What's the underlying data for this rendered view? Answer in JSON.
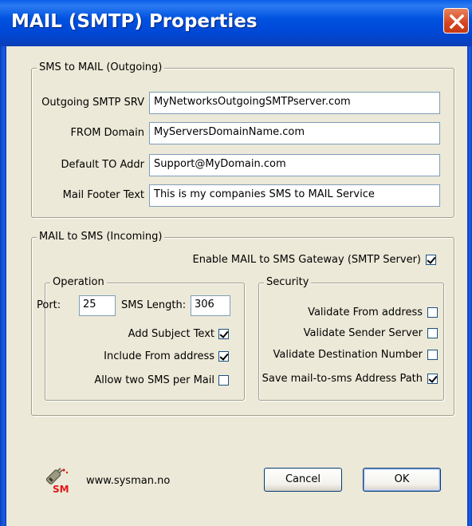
{
  "window": {
    "title": "MAIL (SMTP) Properties"
  },
  "outgoing": {
    "legend": "SMS to MAIL (Outgoing)",
    "smtp_srv_label": "Outgoing SMTP SRV",
    "smtp_srv_value": "MyNetworksOutgoingSMTPserver.com",
    "from_domain_label": "FROM Domain",
    "from_domain_value": "MyServersDomainName.com",
    "default_to_label": "Default TO Addr",
    "default_to_value": "Support@MyDomain.com",
    "footer_label": "Mail Footer Text",
    "footer_value": "This is my companies SMS to MAIL Service"
  },
  "incoming": {
    "legend": "MAIL to SMS (Incoming)",
    "enable_label": "Enable MAIL to SMS Gateway (SMTP Server)",
    "enable_checked": true,
    "operation": {
      "legend": "Operation",
      "port_label": "Port:",
      "port_value": "25",
      "sms_length_label": "SMS Length:",
      "sms_length_value": "306",
      "add_subject_label": "Add Subject Text",
      "add_subject_checked": true,
      "include_from_label": "Include From address",
      "include_from_checked": true,
      "allow_two_label": "Allow two SMS per Mail",
      "allow_two_checked": false
    },
    "security": {
      "legend": "Security",
      "validate_from_label": "Validate From address",
      "validate_from_checked": false,
      "validate_sender_label": "Validate Sender Server",
      "validate_sender_checked": false,
      "validate_dest_label": "Validate Destination Number",
      "validate_dest_checked": false,
      "save_path_label": "Save mail-to-sms Address Path",
      "save_path_checked": true
    }
  },
  "footer": {
    "logo_text": "SM",
    "website": "www.sysman.no",
    "cancel_label": "Cancel",
    "ok_label": "OK"
  },
  "colors": {
    "titlebar": "#0052E0",
    "face": "#ECE9D8",
    "close": "#D6451F",
    "logo_red": "#E01818"
  }
}
